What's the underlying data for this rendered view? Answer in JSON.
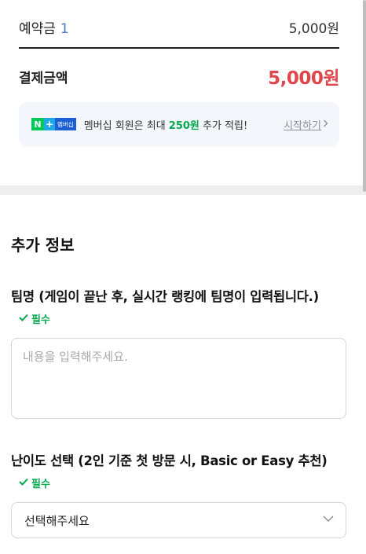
{
  "payment": {
    "deposit_label": "예약금",
    "deposit_count": "1",
    "deposit_amount": "5,000원",
    "total_label": "결제금액",
    "total_amount": "5,000원"
  },
  "promo": {
    "logo_n": "N",
    "logo_plus": "+",
    "logo_membership": "멤버십",
    "text_before": "멤버십 회원은 최대 ",
    "points": "250원",
    "text_after": " 추가 적립!",
    "link_label": "시작하기",
    "link_icon": "chevron-right-icon"
  },
  "additional_info": {
    "section_title": "추가 정보",
    "team_name": {
      "label": "팀명 (게임이 끝난 후, 실시간 랭킹에 팀명이 입력됩니다.)",
      "required_label": "필수",
      "placeholder": "내용을 입력해주세요."
    },
    "difficulty": {
      "label": "난이도 선택 (2인 기준 첫 방문 시, Basic or Easy 추천)",
      "required_label": "필수",
      "selected_value": "선택해주세요",
      "icon": "chevron-down-icon"
    }
  },
  "colors": {
    "accent_green": "#03a94c",
    "price_red": "#e0474c",
    "count_blue": "#4a78c6"
  }
}
